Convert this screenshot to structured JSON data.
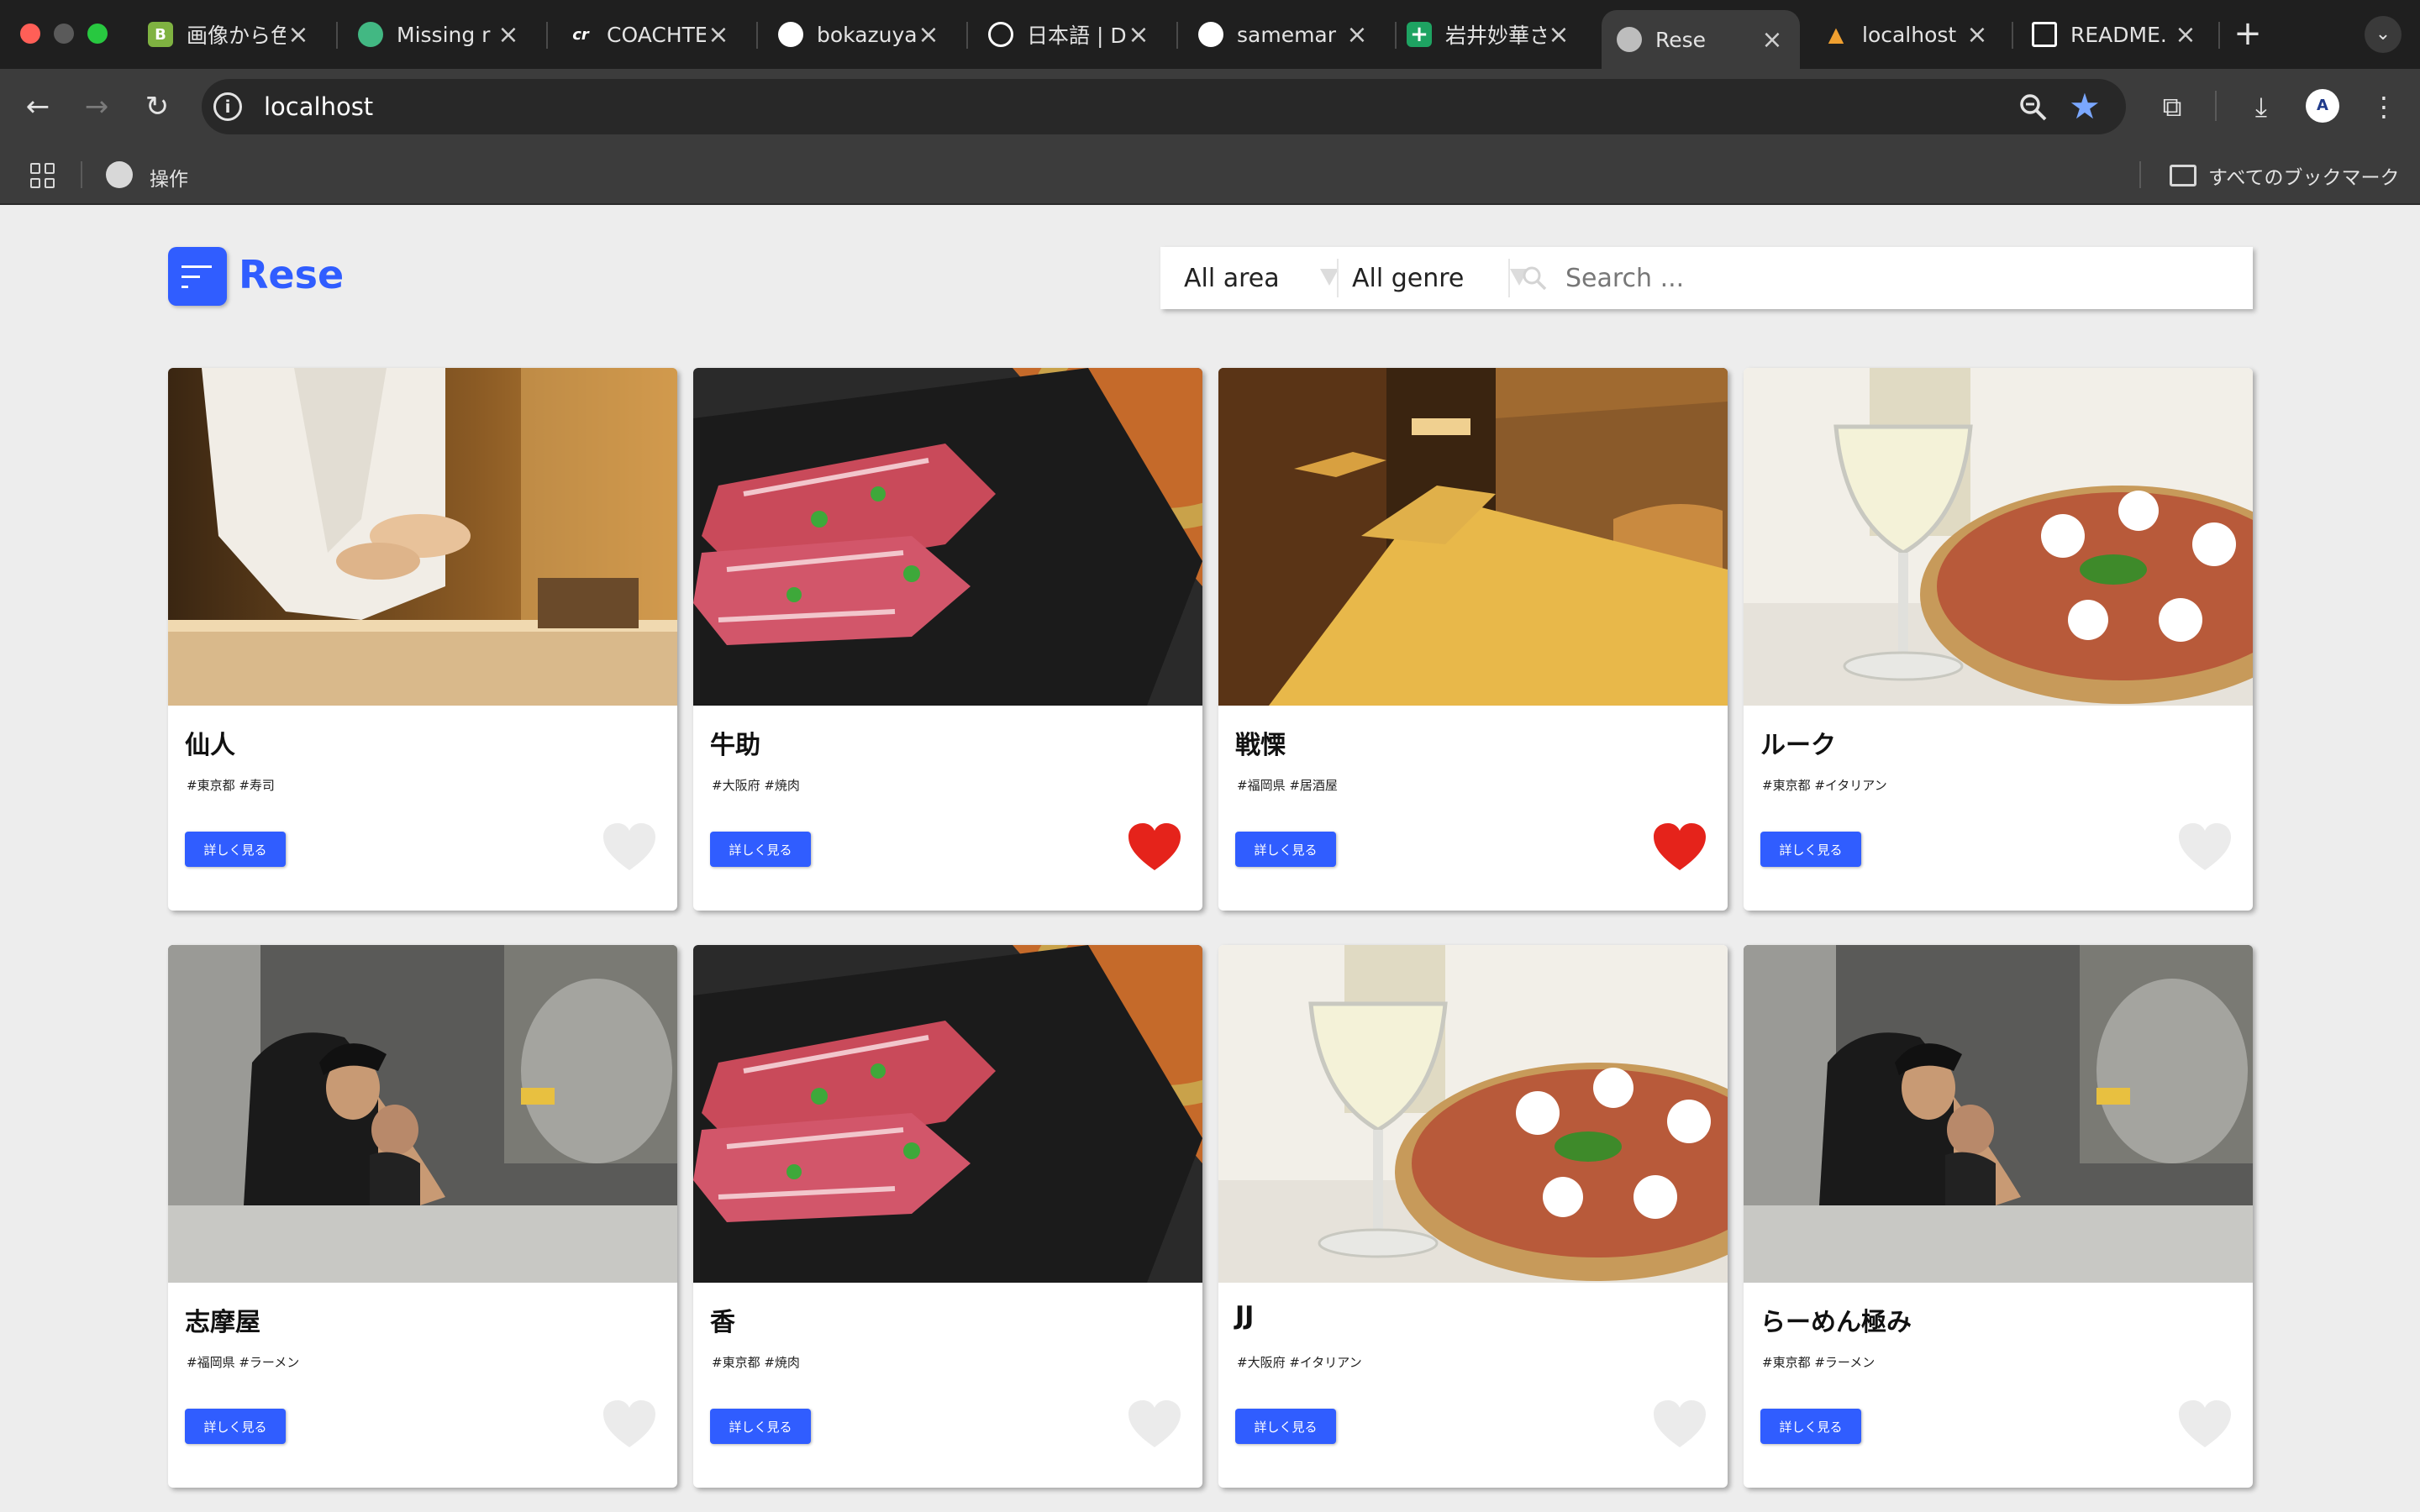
{
  "browser": {
    "tabs": [
      {
        "title": "画像から色",
        "favicon": "doc-icon",
        "color": "#7fb241"
      },
      {
        "title": "Missing r",
        "favicon": "circle-icon",
        "color": "#42b883"
      },
      {
        "title": "COACHTE",
        "favicon": "ct-icon",
        "color": "#111111"
      },
      {
        "title": "bokazuya",
        "favicon": "github-icon",
        "color": "#ffffff"
      },
      {
        "title": "日本語 | D",
        "favicon": "openai-icon",
        "color": "#ffffff"
      },
      {
        "title": "samemar",
        "favicon": "github-icon",
        "color": "#ffffff"
      },
      {
        "title": "岩井妙華さ",
        "favicon": "sheets-icon",
        "color": "#1ea362"
      },
      {
        "title": "Rese",
        "favicon": "globe-icon",
        "color": "#bdbdbd"
      },
      {
        "title": "localhost",
        "favicon": "laravel-icon",
        "color": "#f0a030"
      },
      {
        "title": "README.",
        "favicon": "notion-icon",
        "color": "#ffffff"
      }
    ],
    "url": "localhost",
    "bookmark_label": "操作",
    "all_bookmarks": "すべてのブックマーク"
  },
  "header": {
    "brand": "Rese",
    "area_select": "All area",
    "genre_select": "All genre",
    "search_placeholder": "Search ..."
  },
  "colors": {
    "accent": "#305dff",
    "favorite": "#e5231b",
    "unfavorite": "#ebebeb"
  },
  "shops": [
    {
      "name": "仙人",
      "tags": "#東京都 #寿司",
      "detail": "詳しく見る",
      "favorite": false,
      "photo": "sushi"
    },
    {
      "name": "牛助",
      "tags": "#大阪府 #焼肉",
      "detail": "詳しく見る",
      "favorite": true,
      "photo": "yakiniku"
    },
    {
      "name": "戦慄",
      "tags": "#福岡県 #居酒屋",
      "detail": "詳しく見る",
      "favorite": true,
      "photo": "izakaya"
    },
    {
      "name": "ルーク",
      "tags": "#東京都 #イタリアン",
      "detail": "詳しく見る",
      "favorite": false,
      "photo": "italian"
    },
    {
      "name": "志摩屋",
      "tags": "#福岡県 #ラーメン",
      "detail": "詳しく見る",
      "favorite": false,
      "photo": "ramen"
    },
    {
      "name": "香",
      "tags": "#東京都 #焼肉",
      "detail": "詳しく見る",
      "favorite": false,
      "photo": "yakiniku"
    },
    {
      "name": "JJ",
      "tags": "#大阪府 #イタリアン",
      "detail": "詳しく見る",
      "favorite": false,
      "photo": "italian"
    },
    {
      "name": "らーめん極み",
      "tags": "#東京都 #ラーメン",
      "detail": "詳しく見る",
      "favorite": false,
      "photo": "ramen"
    }
  ]
}
